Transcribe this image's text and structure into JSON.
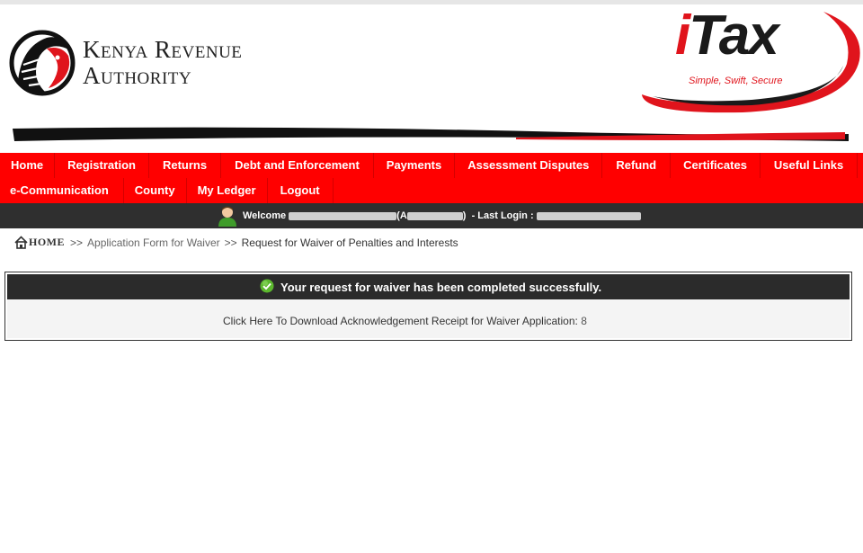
{
  "header": {
    "org_line1": "Kenya Revenue",
    "org_line2": "Authority",
    "brand_i": "i",
    "brand_rest": "Tax",
    "tagline": "Simple, Swift, Secure"
  },
  "nav": {
    "row1": [
      "Home",
      "Registration",
      "Returns",
      "Debt and Enforcement",
      "Payments",
      "Assessment Disputes",
      "Refund",
      "Certificates",
      "Useful Links"
    ],
    "row2": [
      "e-Communication",
      "County",
      "My Ledger",
      "Logout"
    ]
  },
  "welcome": {
    "prefix": "Welcome",
    "pin_open": "(A",
    "pin_close": ")",
    "last_login_label": "- Last Login :"
  },
  "breadcrumb": {
    "home": "HOME",
    "sep": ">>",
    "item1": "Application Form for Waiver",
    "item2": "Request for Waiver of Penalties and Interests"
  },
  "panel": {
    "success_message": "Your request for waiver has been completed successfully.",
    "download_text": "Click Here To Download Acknowledgement Receipt for Waiver Application:",
    "application_no": "8"
  },
  "colors": {
    "nav_red": "#ff0000",
    "dark_bar": "#2f2f2f",
    "brand_red": "#e0141c",
    "success_green": "#5cb82e"
  },
  "icons": {
    "user": "user-avatar-icon",
    "home": "home-icon",
    "success": "check-circle-icon"
  }
}
